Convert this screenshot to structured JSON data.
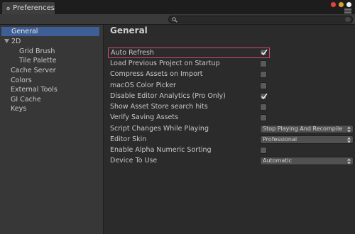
{
  "window": {
    "tab_title": "Preferences",
    "tab_icon": "gear-icon",
    "controls": [
      {
        "name": "close-button",
        "color": "#e0443e"
      },
      {
        "name": "minimize-button",
        "color": "#dea123"
      },
      {
        "name": "maximize-button",
        "color": "#f0f0f0"
      }
    ]
  },
  "search": {
    "placeholder": "",
    "value": ""
  },
  "sidebar": {
    "items": [
      {
        "label": "General",
        "selected": true
      },
      {
        "label": "2D",
        "expanded": true
      },
      {
        "label": "Grid Brush"
      },
      {
        "label": "Tile Palette"
      },
      {
        "label": "Cache Server"
      },
      {
        "label": "Colors"
      },
      {
        "label": "External Tools"
      },
      {
        "label": "GI Cache"
      },
      {
        "label": "Keys"
      }
    ]
  },
  "main": {
    "title": "General",
    "settings": [
      {
        "label": "Auto Refresh",
        "type": "checkbox",
        "checked": true,
        "highlighted": true
      },
      {
        "label": "Load Previous Project on Startup",
        "type": "checkbox",
        "checked": false
      },
      {
        "label": "Compress Assets on Import",
        "type": "checkbox",
        "checked": false
      },
      {
        "label": "macOS Color Picker",
        "type": "checkbox",
        "checked": false
      },
      {
        "label": "Disable Editor Analytics (Pro Only)",
        "type": "checkbox",
        "checked": true
      },
      {
        "label": "Show Asset Store search hits",
        "type": "checkbox",
        "checked": false
      },
      {
        "label": "Verify Saving Assets",
        "type": "checkbox",
        "checked": false
      },
      {
        "label": "Script Changes While Playing",
        "type": "dropdown",
        "value": "Stop Playing And Recompile"
      },
      {
        "label": "Editor Skin",
        "type": "dropdown",
        "value": "Professional"
      },
      {
        "label": "Enable Alpha Numeric Sorting",
        "type": "checkbox",
        "checked": false
      },
      {
        "label": "Device To Use",
        "type": "dropdown",
        "value": "Automatic"
      }
    ]
  },
  "colors": {
    "selection": "#3e5f96",
    "highlight_border": "#d64870",
    "background": "#2b2b2b",
    "sidebar": "#373737"
  }
}
